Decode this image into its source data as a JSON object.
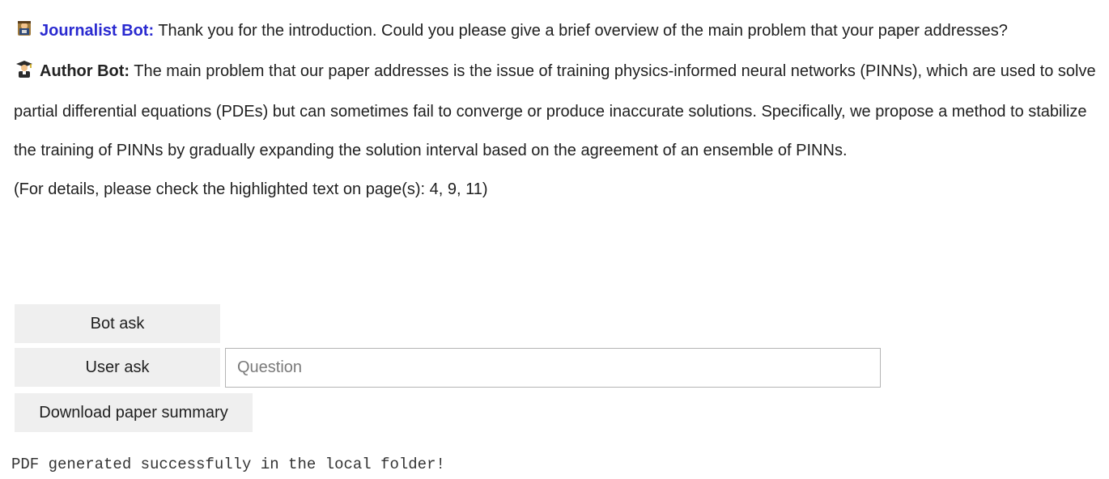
{
  "conversation": {
    "journalist": {
      "icon": "journalist-emoji-icon",
      "name": "Journalist Bot:",
      "text": "Thank you for the introduction. Could you please give a brief overview of the main problem that your paper addresses?"
    },
    "author": {
      "icon": "graduate-emoji-icon",
      "name": "Author Bot:",
      "text": "The main problem that our paper addresses is the issue of training physics-informed neural networks (PINNs), which are used to solve partial differential equations (PDEs) but can sometimes fail to converge or produce inaccurate solutions. Specifically, we propose a method to stabilize the training of PINNs by gradually expanding the solution interval based on the agreement of an ensemble of PINNs."
    },
    "details": "(For details, please check the highlighted text on page(s): 4, 9, 11)"
  },
  "controls": {
    "bot_ask_label": "Bot ask",
    "user_ask_label": "User ask",
    "question_placeholder": "Question",
    "question_value": "",
    "download_label": "Download paper summary"
  },
  "status": {
    "message": "PDF generated successfully in the local folder!"
  },
  "colors": {
    "journalist_name": "#2a2ad0",
    "button_bg": "#efefef",
    "input_border": "#b4b4b4"
  }
}
